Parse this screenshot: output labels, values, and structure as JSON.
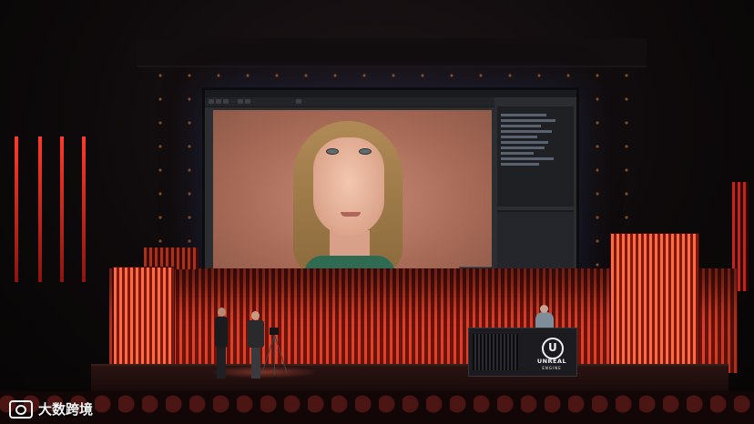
{
  "scene": {
    "description_keys": [
      "keynote-stage",
      "curved-led-screen",
      "unreal-editor",
      "metahuman-face"
    ]
  },
  "podium": {
    "logo_line1": "UNREAL",
    "logo_line2": "ENGINE"
  },
  "watermark": {
    "text": "大数跨境"
  },
  "colors": {
    "stage_red": "#e0402a",
    "editor_bg": "#2b2d31",
    "skin_backdrop": "#b47866"
  }
}
